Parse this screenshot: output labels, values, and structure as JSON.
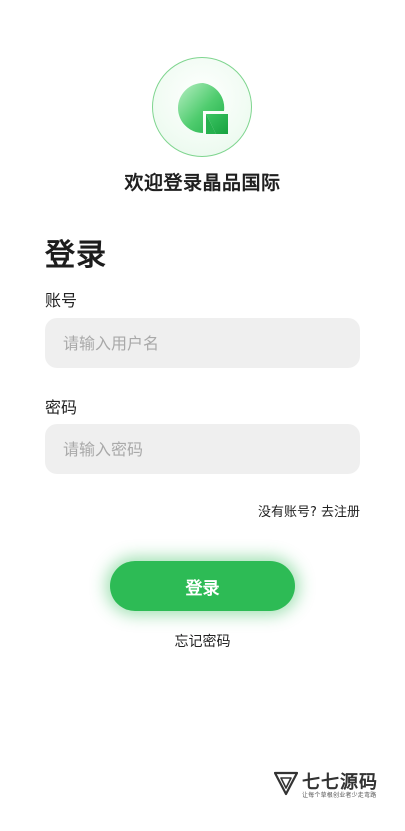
{
  "header": {
    "logo_icon": "brand-logo-icon",
    "welcome_text": "欢迎登录晶品国际"
  },
  "form": {
    "title": "登录",
    "account_label": "账号",
    "account_placeholder": "请输入用户名",
    "account_value": "",
    "password_label": "密码",
    "password_placeholder": "请输入密码",
    "password_value": "",
    "no_account_text": "没有账号?",
    "register_link": "去注册",
    "login_button": "登录",
    "forgot_password": "忘记密码"
  },
  "watermark": {
    "title": "七七源码",
    "subtitle": "让每个草根创业者少走弯路"
  },
  "colors": {
    "accent": "#2dbb55",
    "input_bg": "#efefef",
    "logo_ring": "#7fd58f"
  }
}
